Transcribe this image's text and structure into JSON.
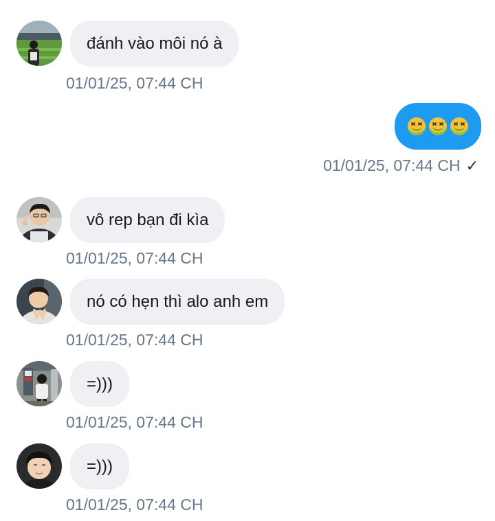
{
  "messages": [
    {
      "text": "đánh vào môi nó à",
      "time": "01/01/25, 07:44 CH"
    },
    {
      "text": "vô rep bạn đi kìa",
      "time": "01/01/25, 07:44 CH"
    },
    {
      "text": "nó có hẹn thì alo anh em",
      "time": "01/01/25, 07:44 CH"
    },
    {
      "text": "=)))",
      "time": "01/01/25, 07:44 CH"
    },
    {
      "text": "=)))",
      "time": "01/01/25, 07:44 CH"
    }
  ],
  "outgoing": {
    "emoji_icons": [
      "nauseated-face-icon",
      "nauseated-face-icon",
      "nauseated-face-icon"
    ],
    "time": "01/01/25, 07:44 CH",
    "status_mark": "✓"
  },
  "colors": {
    "incoming_bubble": "#eef0f3",
    "outgoing_bubble": "#1d9bf0",
    "timestamp": "#66778a"
  }
}
